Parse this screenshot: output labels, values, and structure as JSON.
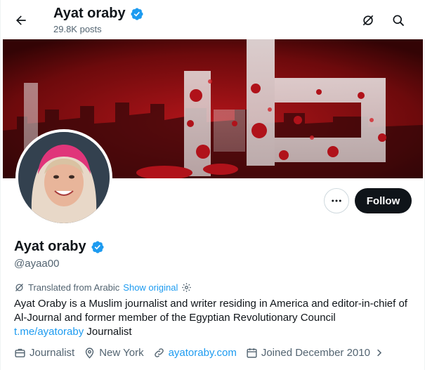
{
  "header": {
    "title": "Ayat oraby",
    "posts_count": "29.8K posts"
  },
  "banner": {
    "text_overlay": "حلب",
    "accent_color": "#b3151a"
  },
  "actions": {
    "follow_label": "Follow",
    "more_label": "More"
  },
  "profile": {
    "name": "Ayat oraby",
    "handle": "@ayaa00",
    "verified_color": "#1d9bf0",
    "translation": {
      "note": "Translated from Arabic",
      "show_original": "Show original"
    },
    "bio": {
      "text": "Ayat Oraby is a Muslim journalist and writer residing in America and editor-in-chief of Al-Journal and former member of the Egyptian Revolutionary Council",
      "link": "t.me/ayatoraby",
      "suffix": " Journalist"
    },
    "meta": {
      "profession": "Journalist",
      "location": "New York",
      "website": "ayatoraby.com",
      "joined": "Joined December 2010"
    }
  },
  "icons": [
    "back-arrow-icon",
    "verified-badge-icon",
    "no-notifications-icon",
    "search-icon",
    "more-dots-icon",
    "translate-icon",
    "settings-icon",
    "briefcase-icon",
    "location-pin-icon",
    "link-icon",
    "calendar-icon",
    "chevron-right-icon"
  ]
}
